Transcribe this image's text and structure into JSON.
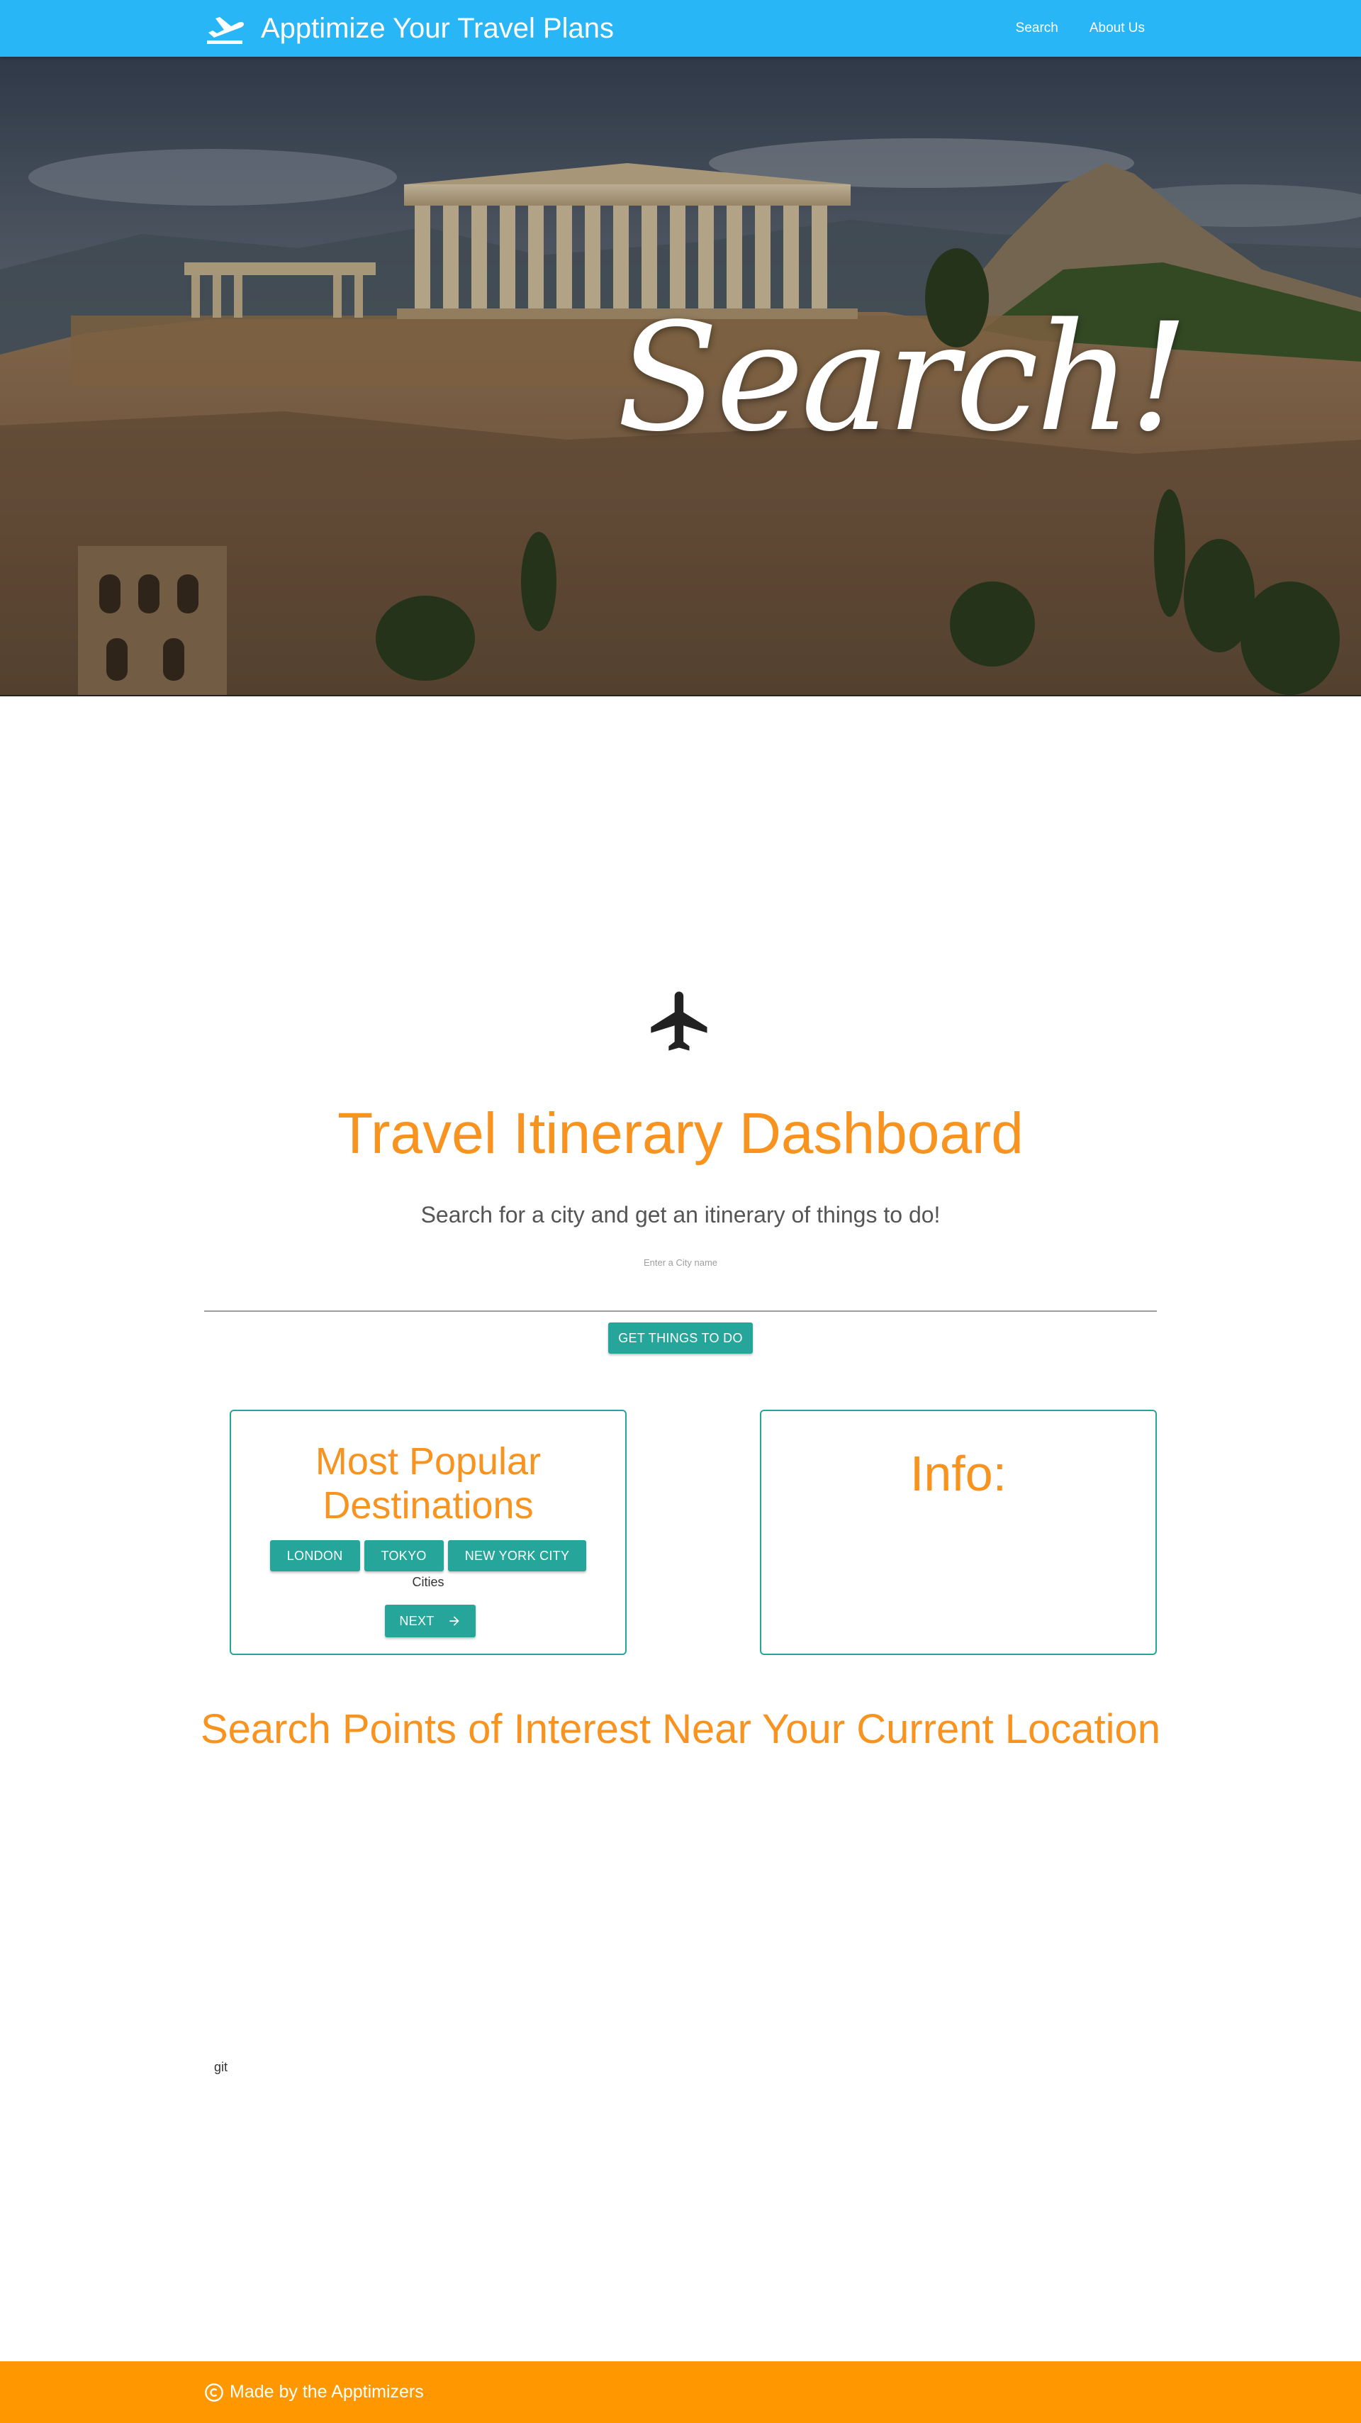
{
  "navbar": {
    "brand_icon": "flight-takeoff-icon",
    "title": "Apptimize Your Travel Plans",
    "links": [
      {
        "label": "Search"
      },
      {
        "label": "About Us"
      }
    ],
    "color": "#29b6f6"
  },
  "hero": {
    "text": "Search!"
  },
  "dashboard": {
    "icon": "airplane-icon",
    "title": "Travel Itinerary Dashboard",
    "subtitle": "Search for a city and get an itinerary of things to do!",
    "search_placeholder": "Enter a City name",
    "search_value": "",
    "button_label": "GET THINGS TO DO",
    "accent_color": "#f7931e",
    "button_color": "#26a69a"
  },
  "popular": {
    "title": "Most Popular Destinations",
    "destinations": [
      {
        "label": "LONDON"
      },
      {
        "label": "TOKYO"
      },
      {
        "label": "NEW YORK CITY"
      }
    ],
    "cities_label": "Cities",
    "next_label": "NEXT",
    "next_icon": "arrow-right-icon"
  },
  "info": {
    "title": "Info:"
  },
  "poi": {
    "title": "Search Points of Interest Near Your Current Location"
  },
  "misc": {
    "git_text": "git"
  },
  "footer": {
    "icon": "copyright-icon",
    "text": "Made by the Apptimizers",
    "color": "#ff9800"
  }
}
